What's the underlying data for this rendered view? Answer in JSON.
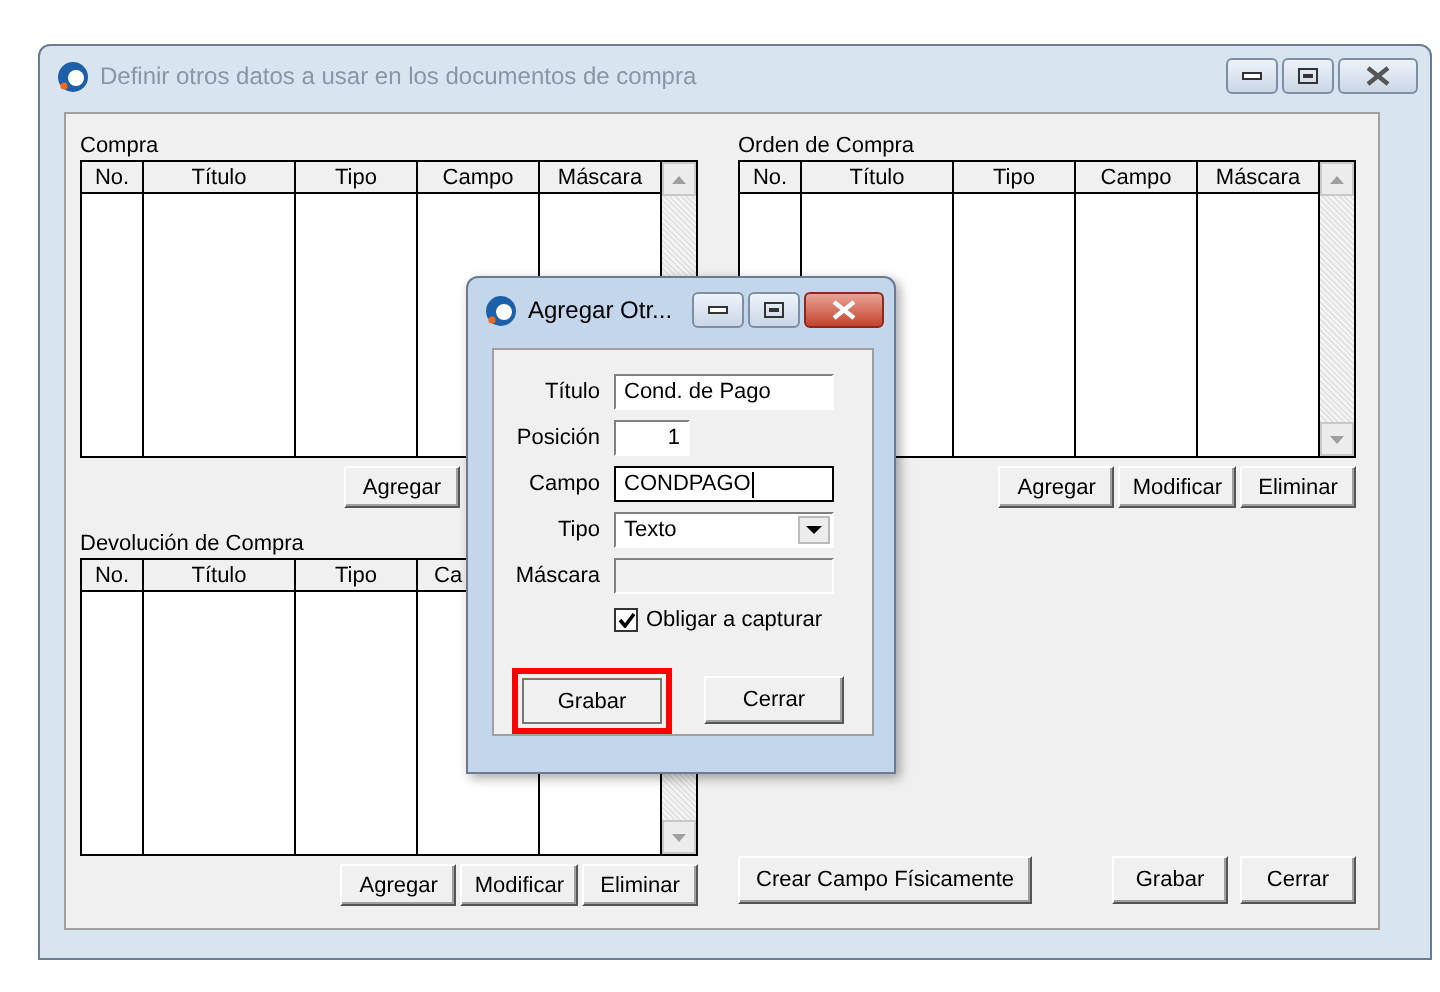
{
  "main_window": {
    "title": "Definir otros datos a usar en los documentos de compra",
    "active": false
  },
  "groups": [
    {
      "label": "Compra",
      "columns": [
        "No.",
        "Título",
        "Tipo",
        "Campo",
        "Máscara"
      ],
      "buttons": [
        "Agregar"
      ]
    },
    {
      "label": "Orden de Compra",
      "columns": [
        "No.",
        "Título",
        "Tipo",
        "Campo",
        "Máscara"
      ],
      "buttons": [
        "Agregar",
        "Modificar",
        "Eliminar"
      ]
    },
    {
      "label": "Devolución de Compra",
      "columns": [
        "No.",
        "Título",
        "Tipo",
        "Ca"
      ],
      "buttons": [
        "Agregar",
        "Modificar",
        "Eliminar"
      ]
    }
  ],
  "footer_buttons": [
    {
      "label": "Crear Campo Físicamente",
      "kind": "left"
    },
    {
      "label": "Grabar",
      "kind": "right"
    },
    {
      "label": "Cerrar",
      "kind": "right"
    }
  ],
  "dialog": {
    "title": "Agregar Otr...",
    "active": true,
    "fields": [
      {
        "kind": "text",
        "label": "Título",
        "value": "Cond. de Pago",
        "focused": false,
        "disabled": false
      },
      {
        "kind": "number",
        "label": "Posición",
        "value": "1",
        "focused": false,
        "disabled": false
      },
      {
        "kind": "text",
        "label": "Campo",
        "value": "CONDPAGO",
        "focused": true,
        "disabled": false
      },
      {
        "kind": "select",
        "label": "Tipo",
        "value": "Texto"
      },
      {
        "kind": "text",
        "label": "Máscara",
        "focused": false,
        "disabled": true
      }
    ],
    "checkbox": {
      "label": "Obligar a capturar",
      "checked": true
    },
    "buttons": [
      {
        "label": "Grabar",
        "highlighted": true
      },
      {
        "label": "Cerrar",
        "highlighted": false
      }
    ]
  }
}
